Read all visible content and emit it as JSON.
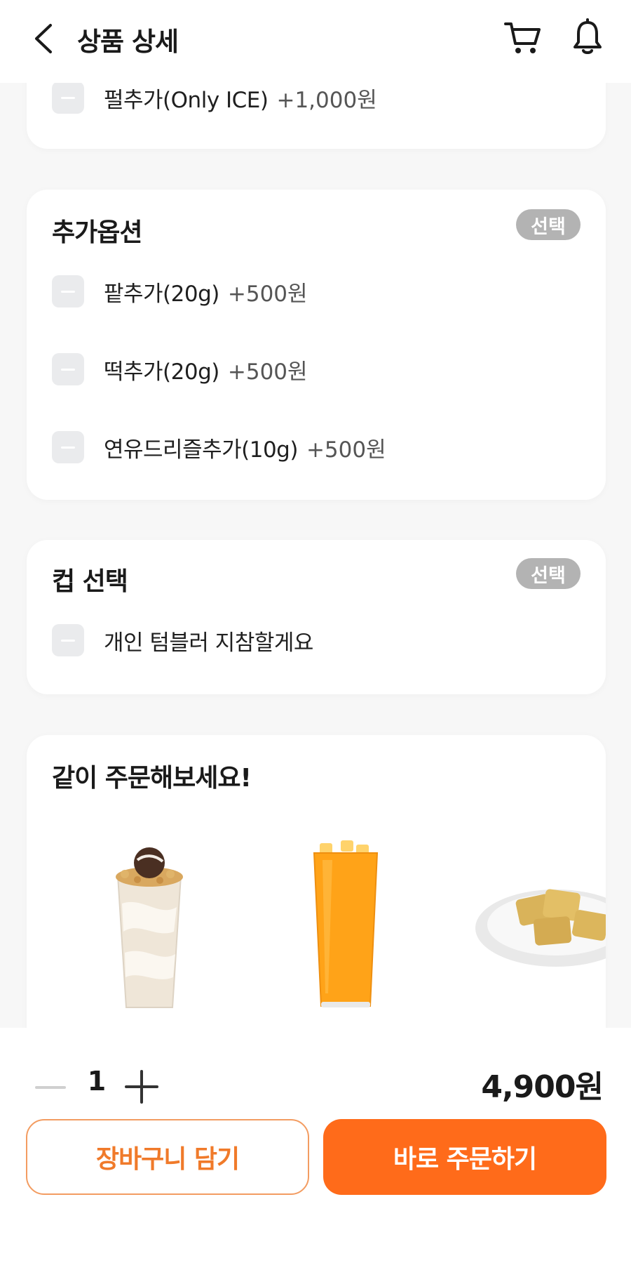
{
  "header": {
    "title": "상품 상세",
    "icons": [
      "back-icon",
      "cart-icon",
      "bell-icon"
    ]
  },
  "top_option": {
    "label": "펄추가(Only ICE)",
    "price": "+1,000원"
  },
  "extra_options": {
    "title": "추가옵션",
    "badge": "선택",
    "items": [
      {
        "label": "팥추가(20g)",
        "price": "+500원"
      },
      {
        "label": "떡추가(20g)",
        "price": "+500원"
      },
      {
        "label": "연유드리즐추가(10g)",
        "price": "+500원"
      }
    ]
  },
  "cup_select": {
    "title": "컵 선택",
    "badge": "선택",
    "items": [
      {
        "label": "개인 텀블러 지참할게요"
      }
    ]
  },
  "recommend": {
    "title": "같이 주문해보세요!",
    "items": [
      "milkshake-image",
      "orange-juice-image",
      "injeolmi-plate-image"
    ]
  },
  "order": {
    "quantity": "1",
    "total": "4,900원",
    "cart_button": "장바구니 담기",
    "order_button": "바로 주문하기"
  },
  "colors": {
    "accent": "#ff6b1a",
    "badge": "#b3b3b3",
    "checkbox": "#eaebed"
  }
}
